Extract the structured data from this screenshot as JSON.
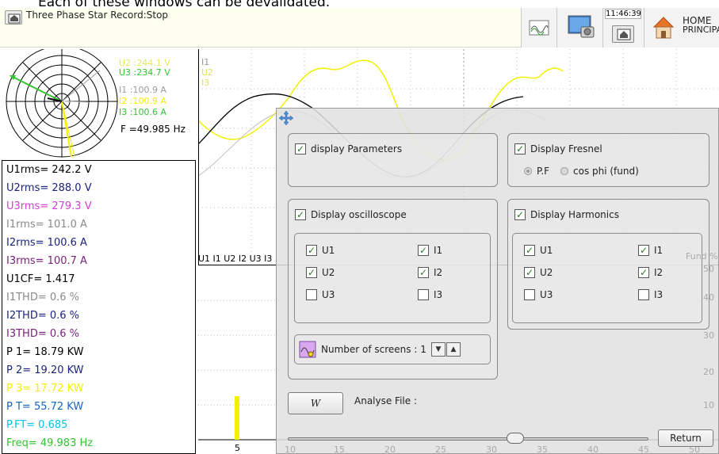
{
  "caption_text": "Each of these windows can be devalidated.",
  "header": {
    "record_title": "Three Phase Star Record:Stop",
    "clock": "11:46:39",
    "home_label_line1": "HOME",
    "home_label_line2": "PRINCIPA"
  },
  "fresnel": {
    "u2": "U2 :244.1 V",
    "u3": "U3 :234.7 V",
    "i1": "I1 :100.9 A",
    "i2": "I2 :100.9 A",
    "i3": "I3 :100.6 A",
    "freq": "F  =49.985 Hz"
  },
  "measurements": [
    {
      "text": "U1rms=  242.2  V",
      "color": "#000000"
    },
    {
      "text": "U2rms=  288.0  V",
      "color": "#1a237e"
    },
    {
      "text": "U3rms=  279.3  V",
      "color": "#d63cd6"
    },
    {
      "text": "I1rms=  101.0  A",
      "color": "#8a8a8a"
    },
    {
      "text": "I2rms=  100.6  A",
      "color": "#1a237e"
    },
    {
      "text": "I3rms=  100.7  A",
      "color": "#7a1f7a"
    },
    {
      "text": "U1CF=  1.417",
      "color": "#000000"
    },
    {
      "text": "I1THD=  0.6  %",
      "color": "#8a8a8a"
    },
    {
      "text": "I2THD=  0.6  %",
      "color": "#1a237e"
    },
    {
      "text": "I3THD=  0.6  %",
      "color": "#7a1f7a"
    },
    {
      "text": "P  1=  18.79  KW",
      "color": "#000000"
    },
    {
      "text": "P  2=  19.20  KW",
      "color": "#1a237e"
    },
    {
      "text": "P  3=  17.72  KW",
      "color": "#f2f200"
    },
    {
      "text": "P  T=  55.72  KW",
      "color": "#1565c0"
    },
    {
      "text": "P.FT=  0.685",
      "color": "#00c4e8"
    },
    {
      "text": "Freq=  49.983  Hz",
      "color": "#33c433"
    }
  ],
  "scope": {
    "ch_i1": "I1",
    "ch_u2": "U2",
    "ch_i3": "I3",
    "harm_strip": "U1 I1 U2 I2 U3 I3",
    "harm_axis_label": "Fund %",
    "harm_y_ticks": [
      "50",
      "40",
      "30",
      "20",
      "10"
    ],
    "harm_x_ticks": [
      "5",
      "10",
      "15",
      "20",
      "25",
      "30",
      "35",
      "40",
      "45",
      "50"
    ],
    "harm_bar_rank": 5,
    "harm_bar_pct": 0.25
  },
  "dialog": {
    "display_parameters": "display Parameters",
    "display_fresnel": "Display Fresnel",
    "radio_pf": "P.F",
    "radio_cosphi": "cos phi (fund)",
    "display_oscilloscope": "Display oscilloscope",
    "display_harmonics": "Display Harmonics",
    "osc_channels": {
      "u1": "U1",
      "u2": "U2",
      "u3": "U3",
      "i1": "I1",
      "i2": "I2",
      "i3": "I3"
    },
    "harm_channels": {
      "u1": "U1",
      "u2": "U2",
      "u3": "U3",
      "i1": "I1",
      "i2": "I2",
      "i3": "I3"
    },
    "number_of_screens": "Number of screens : 1",
    "analyse_file": "Analyse File :",
    "analyse_btn_glyph": "W",
    "return_label": "Return",
    "checks": {
      "display_parameters": true,
      "display_fresnel": true,
      "display_oscilloscope": true,
      "display_harmonics": true,
      "osc_u1": true,
      "osc_u2": true,
      "osc_u3": false,
      "osc_i1": true,
      "osc_i2": true,
      "osc_i3": false,
      "harm_u1": true,
      "harm_u2": true,
      "harm_u3": false,
      "harm_i1": true,
      "harm_i2": true,
      "harm_i3": false
    },
    "radio_selected": "pf"
  },
  "colors": {
    "u1": "#000000",
    "u2": "#f2f200",
    "u3": "#33c433",
    "i1": "#8a8a8a",
    "i3": "#f2f200",
    "fresnel_u1": "#33c433"
  }
}
